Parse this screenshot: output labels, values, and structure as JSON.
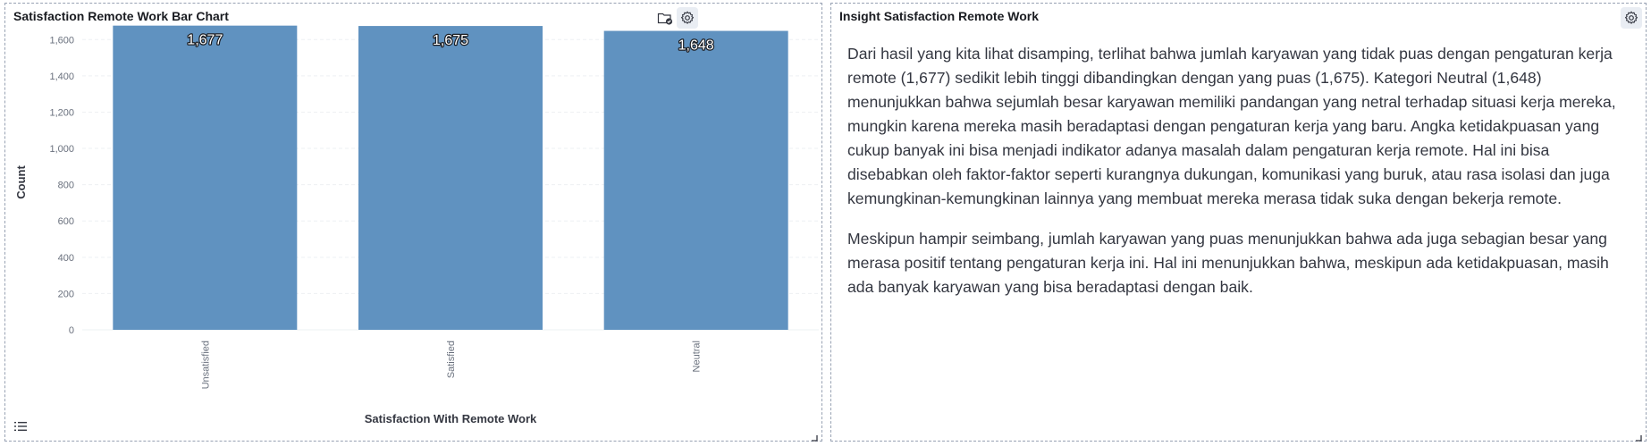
{
  "chart_panel": {
    "title": "Satisfaction Remote Work Bar Chart",
    "icons": [
      "folder-check-icon",
      "gear-icon",
      "list-icon",
      "resize-handle-icon"
    ]
  },
  "insight_panel": {
    "title": "Insight Satisfaction Remote Work",
    "paragraphs": [
      "Dari hasil yang kita lihat disamping, terlihat bahwa jumlah karyawan yang tidak puas dengan pengaturan kerja remote (1,677) sedikit lebih tinggi dibandingkan dengan yang puas (1,675). Kategori Neutral (1,648) menunjukkan bahwa sejumlah besar karyawan memiliki pandangan yang netral terhadap situasi kerja mereka, mungkin karena mereka masih beradaptasi dengan pengaturan kerja yang baru. Angka ketidakpuasan yang cukup banyak ini bisa menjadi indikator adanya masalah dalam pengaturan kerja remote. Hal ini bisa disebabkan oleh faktor-faktor seperti kurangnya dukungan, komunikasi yang buruk, atau rasa isolasi dan juga kemungkinan-kemungkinan lainnya yang membuat mereka merasa tidak suka dengan bekerja remote.",
      "Meskipun hampir seimbang, jumlah karyawan yang puas menunjukkan bahwa ada juga sebagian besar yang merasa positif tentang pengaturan kerja ini. Hal ini menunjukkan bahwa, meskipun ada ketidakpuasan, masih ada banyak karyawan yang bisa beradaptasi dengan baik."
    ]
  },
  "colors": {
    "bar": "#6092c0",
    "grid": "#eef0f3",
    "axis_text": "#69707d"
  },
  "chart_data": {
    "type": "bar",
    "categories": [
      "Unsatisfied",
      "Satisfied",
      "Neutral"
    ],
    "values": [
      1677,
      1675,
      1648
    ],
    "data_labels": [
      "1,677",
      "1,675",
      "1,648"
    ],
    "xlabel": "Satisfaction With Remote Work",
    "ylabel": "Count",
    "ylim": [
      0,
      1700
    ],
    "yticks": [
      0,
      200,
      400,
      600,
      800,
      1000,
      1200,
      1400,
      1600
    ],
    "ytick_labels": [
      "0",
      "200",
      "400",
      "600",
      "800",
      "1,000",
      "1,200",
      "1,400",
      "1,600"
    ],
    "grid": true
  }
}
